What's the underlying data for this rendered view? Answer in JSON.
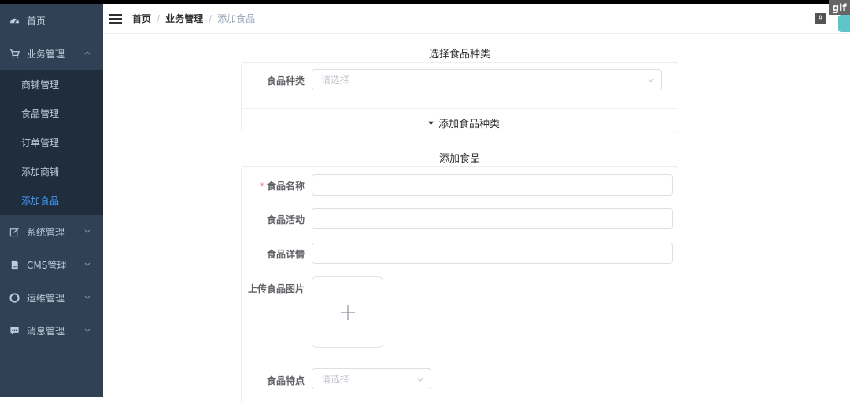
{
  "sidebar": {
    "items": [
      {
        "label": "首页",
        "icon": "dashboard-icon"
      },
      {
        "label": "业务管理",
        "icon": "cart-icon",
        "expanded": true,
        "children": [
          {
            "label": "商铺管理"
          },
          {
            "label": "食品管理"
          },
          {
            "label": "订单管理"
          },
          {
            "label": "添加商铺"
          },
          {
            "label": "添加食品",
            "active": true
          }
        ]
      },
      {
        "label": "系统管理",
        "icon": "edit-icon"
      },
      {
        "label": "CMS管理",
        "icon": "document-icon"
      },
      {
        "label": "运维管理",
        "icon": "lifebuoy-icon"
      },
      {
        "label": "消息管理",
        "icon": "message-icon"
      }
    ]
  },
  "navbar": {
    "breadcrumb": [
      "首页",
      "业务管理",
      "添加食品"
    ],
    "separator": "/",
    "size_icon_label": "A",
    "gif_badge": "gif"
  },
  "category_section": {
    "title": "选择食品种类",
    "label": "食品种类",
    "placeholder": "请选择",
    "toggle_label": "添加食品种类"
  },
  "food_section": {
    "title": "添加食品",
    "name_label": "食品名称",
    "name_required": "*",
    "activity_label": "食品活动",
    "detail_label": "食品详情",
    "upload_label": "上传食品图片",
    "feature_label": "食品特点",
    "feature_placeholder": "请选择"
  },
  "colors": {
    "sidebar_bg": "#304156",
    "submenu_bg": "#1f2d3d",
    "active": "#409eff",
    "required": "#f56c6c"
  }
}
